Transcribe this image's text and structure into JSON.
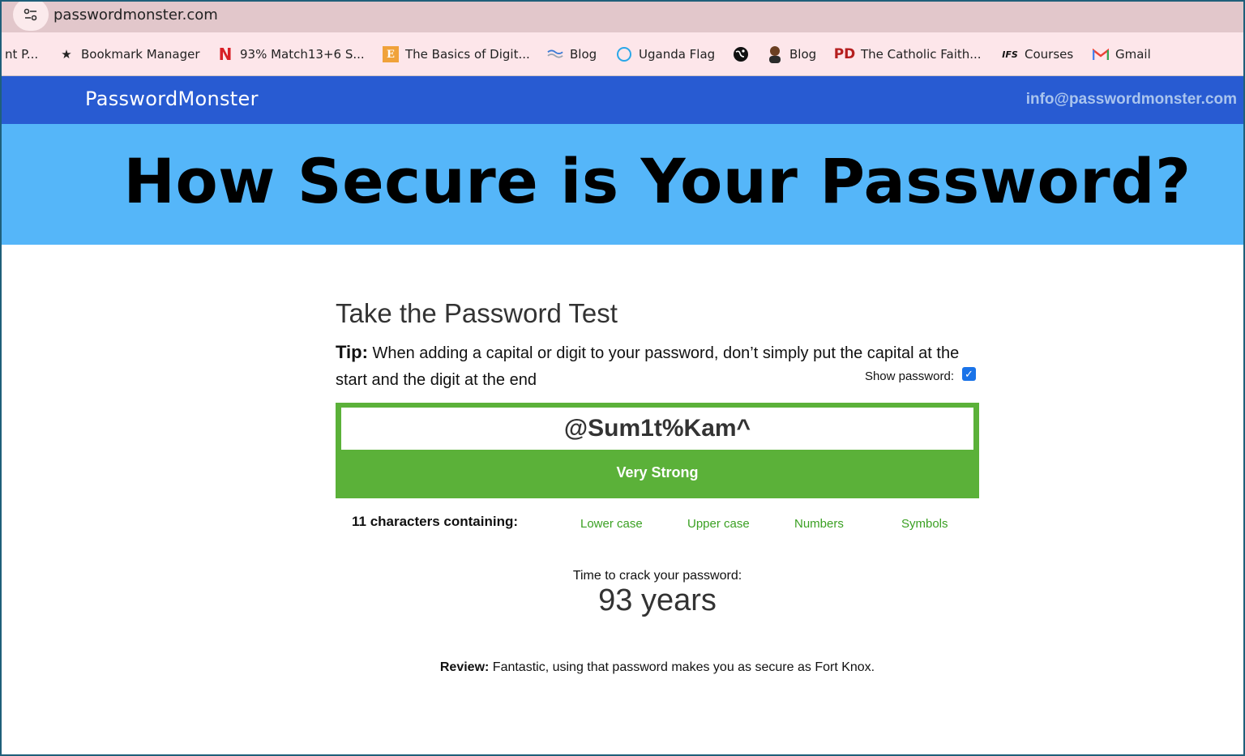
{
  "browser": {
    "url": "passwordmonster.com",
    "bookmarks": [
      {
        "label": "nt P...",
        "icon": "none"
      },
      {
        "label": "Bookmark Manager",
        "icon": "star-icon"
      },
      {
        "label": "93% Match13+6 S...",
        "icon": "netflix-icon"
      },
      {
        "label": "The Basics of Digit...",
        "icon": "e-book-icon"
      },
      {
        "label": "Blog",
        "icon": "wave-icon"
      },
      {
        "label": "Uganda Flag",
        "icon": "circle-icon"
      },
      {
        "label": "",
        "icon": "globe-icon"
      },
      {
        "label": "Blog",
        "icon": "avatar-icon"
      },
      {
        "label": "The Catholic Faith...",
        "icon": "pd-icon"
      },
      {
        "label": "Courses",
        "icon": "ifs-icon"
      },
      {
        "label": "Gmail",
        "icon": "gmail-icon"
      }
    ]
  },
  "site": {
    "brand": "PasswordMonster",
    "email": "info@passwordmonster.com",
    "hero_title": "How Secure is Your Password?"
  },
  "test": {
    "title": "Take the Password Test",
    "tip_label": "Tip:",
    "tip_text": " When adding a capital or digit to your password, don’t simply put the capital at the start and the digit at the end",
    "show_password_label": "Show password:",
    "show_password_checked": true,
    "password_value": "@Sum1t%Kam^",
    "strength": "Very Strong",
    "strength_color": "#5bb139",
    "chars_count": "11 characters containing:",
    "char_types": [
      "Lower case",
      "Upper case",
      "Numbers",
      "Symbols"
    ],
    "crack_label": "Time to crack your password:",
    "crack_time": "93 years",
    "review_label": "Review:",
    "review_text": " Fantastic, using that password makes you as secure as Fort Knox."
  },
  "colors": {
    "header_blue": "#285bd2",
    "hero_blue": "#55b6f9",
    "accent_green": "#5bb139",
    "link_green": "#3aa022"
  }
}
